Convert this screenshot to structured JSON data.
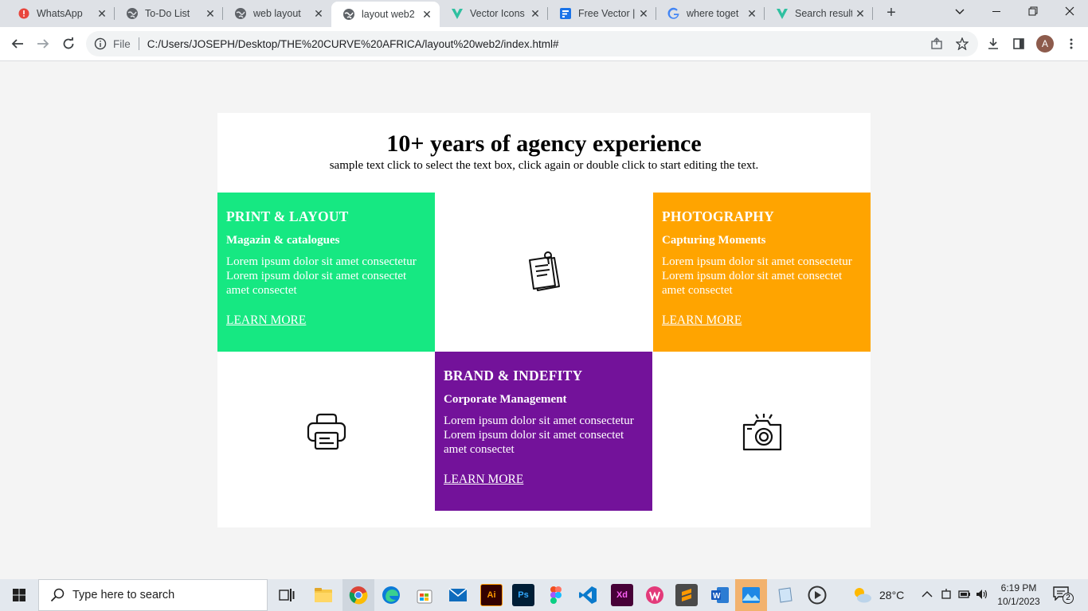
{
  "browser": {
    "tabs": [
      {
        "title": "WhatsApp",
        "icon": "whatsapp-badge-icon",
        "active": false
      },
      {
        "title": "To-Do List",
        "icon": "globe-icon",
        "active": false
      },
      {
        "title": "web layout",
        "icon": "globe-icon",
        "active": false
      },
      {
        "title": "layout web2",
        "icon": "globe-icon",
        "active": true
      },
      {
        "title": "Vector Icons",
        "icon": "vector-logo-icon",
        "active": false
      },
      {
        "title": "Free Vector |",
        "icon": "docs-icon",
        "active": false
      },
      {
        "title": "where toget",
        "icon": "google-icon",
        "active": false
      },
      {
        "title": "Search result",
        "icon": "vector-logo-icon",
        "active": false
      }
    ],
    "address": {
      "scheme_label": "File",
      "url": "C:/Users/JOSEPH/Desktop/THE%20CURVE%20AFRICA/layout%20web2/index.html#"
    },
    "profile_initial": "A"
  },
  "page": {
    "heading": "10+ years of agency experience",
    "subheading": "sample text click to select the text box, click again or double click to start editing the text.",
    "cards": [
      {
        "title": "PRINT & LAYOUT",
        "subtitle": "Magazin & catalogues",
        "body": "Lorem ipsum dolor sit amet consectetur Lorem ipsum dolor sit amet consectet amet consectet",
        "link": "LEARN MORE",
        "color": "#16e882"
      },
      {
        "title": "PHOTOGRAPHY",
        "subtitle": "Capturing Moments",
        "body": "Lorem ipsum dolor sit amet consectetur Lorem ipsum dolor sit amet consectet amet consectet",
        "link": "LEARN MORE",
        "color": "#ffa400"
      },
      {
        "title": "BRAND & INDEFITY",
        "subtitle": "Corporate Management",
        "body": "Lorem ipsum dolor sit amet consectetur Lorem ipsum dolor sit amet consectet amet consectet",
        "link": "LEARN MORE",
        "color": "#73129a"
      }
    ],
    "icons": [
      "notes-clip-icon",
      "printer-icon",
      "camera-icon"
    ]
  },
  "taskbar": {
    "search_placeholder": "Type here to search",
    "weather": "28°C",
    "time": "6:19 PM",
    "date": "10/1/2023",
    "notification_count": "2"
  }
}
